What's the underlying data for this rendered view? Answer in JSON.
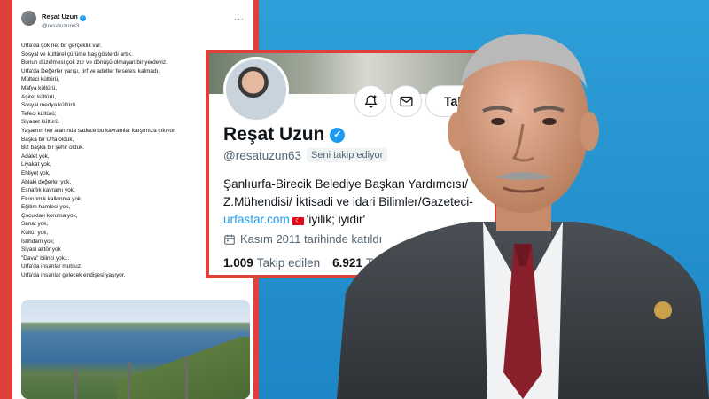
{
  "tweet": {
    "author_name": "Reşat Uzun",
    "author_handle": "@resatuzun63",
    "lines": [
      "Urfa'da çok net bir gerçeklik var.",
      "Sosyal ve kültürel çürüme baş gösterdi artık.",
      "Bunun düzelmesi çok zor ve dönüşü olmayan bir yerdeyiz.",
      "Urfa'da Değerler yarışı, örf ve adetler felsefesi kalmadı.",
      "Mülteci kültürü,",
      "Mafya kültürü,",
      "Aşiret kültürü,",
      "Sosyal medya kültürü",
      "Tefeci kültürü;",
      "Siyaset kültürü.",
      "Yaşamın her alanında sadece bu kavramlar karşımıza çıkıyor.",
      "Başka bir Urfa olduk,",
      "Biz başka bir şehir olduk.",
      "Adalet yok,",
      "Liyakat yok,",
      "Ehliyet yok,",
      "Ahlaki değerler yok,",
      "Esnaflık kavramı yok,",
      "Ekonomik kalkınma yok,",
      "Eğitim hamlesi yok,",
      "Çocukları koruma yok,",
      "Sanat yok,",
      "Kültür yok,",
      "İstihdam yok;",
      "Siyasi aktör yok",
      "\"Dava\" bilinci yok...",
      "Urfa'da insanlar mutsuz.",
      "Urfa'da insanlar gelecek endişesi yaşıyor."
    ]
  },
  "profile": {
    "name": "Reşat Uzun",
    "handle": "@resatuzun63",
    "follows_you": "Seni takip ediyor",
    "follow_button": "Takip e",
    "bio_line1": "Şanlıurfa-Birecik Belediye Başkan Yardımcısı/",
    "bio_line2": "Z.Mühendisi/ İktisadi ve idari Bilimler/Gazeteci-",
    "bio_link": "urfastar.com",
    "bio_tail": "'iyilik; iyidir'",
    "joined": "Kasım 2011 tarihinde katıldı",
    "following_count": "1.009",
    "following_label": "Takip edilen",
    "followers_count": "6.921",
    "followers_label": "Takipçi"
  },
  "colors": {
    "accent": "#1d9bf0",
    "frame_red": "#e0403a",
    "background_blue": "#2196d3"
  },
  "icons": [
    "more-icon",
    "verified-icon",
    "notify-bell-icon",
    "message-icon",
    "calendar-icon",
    "turkish-flag-icon"
  ]
}
